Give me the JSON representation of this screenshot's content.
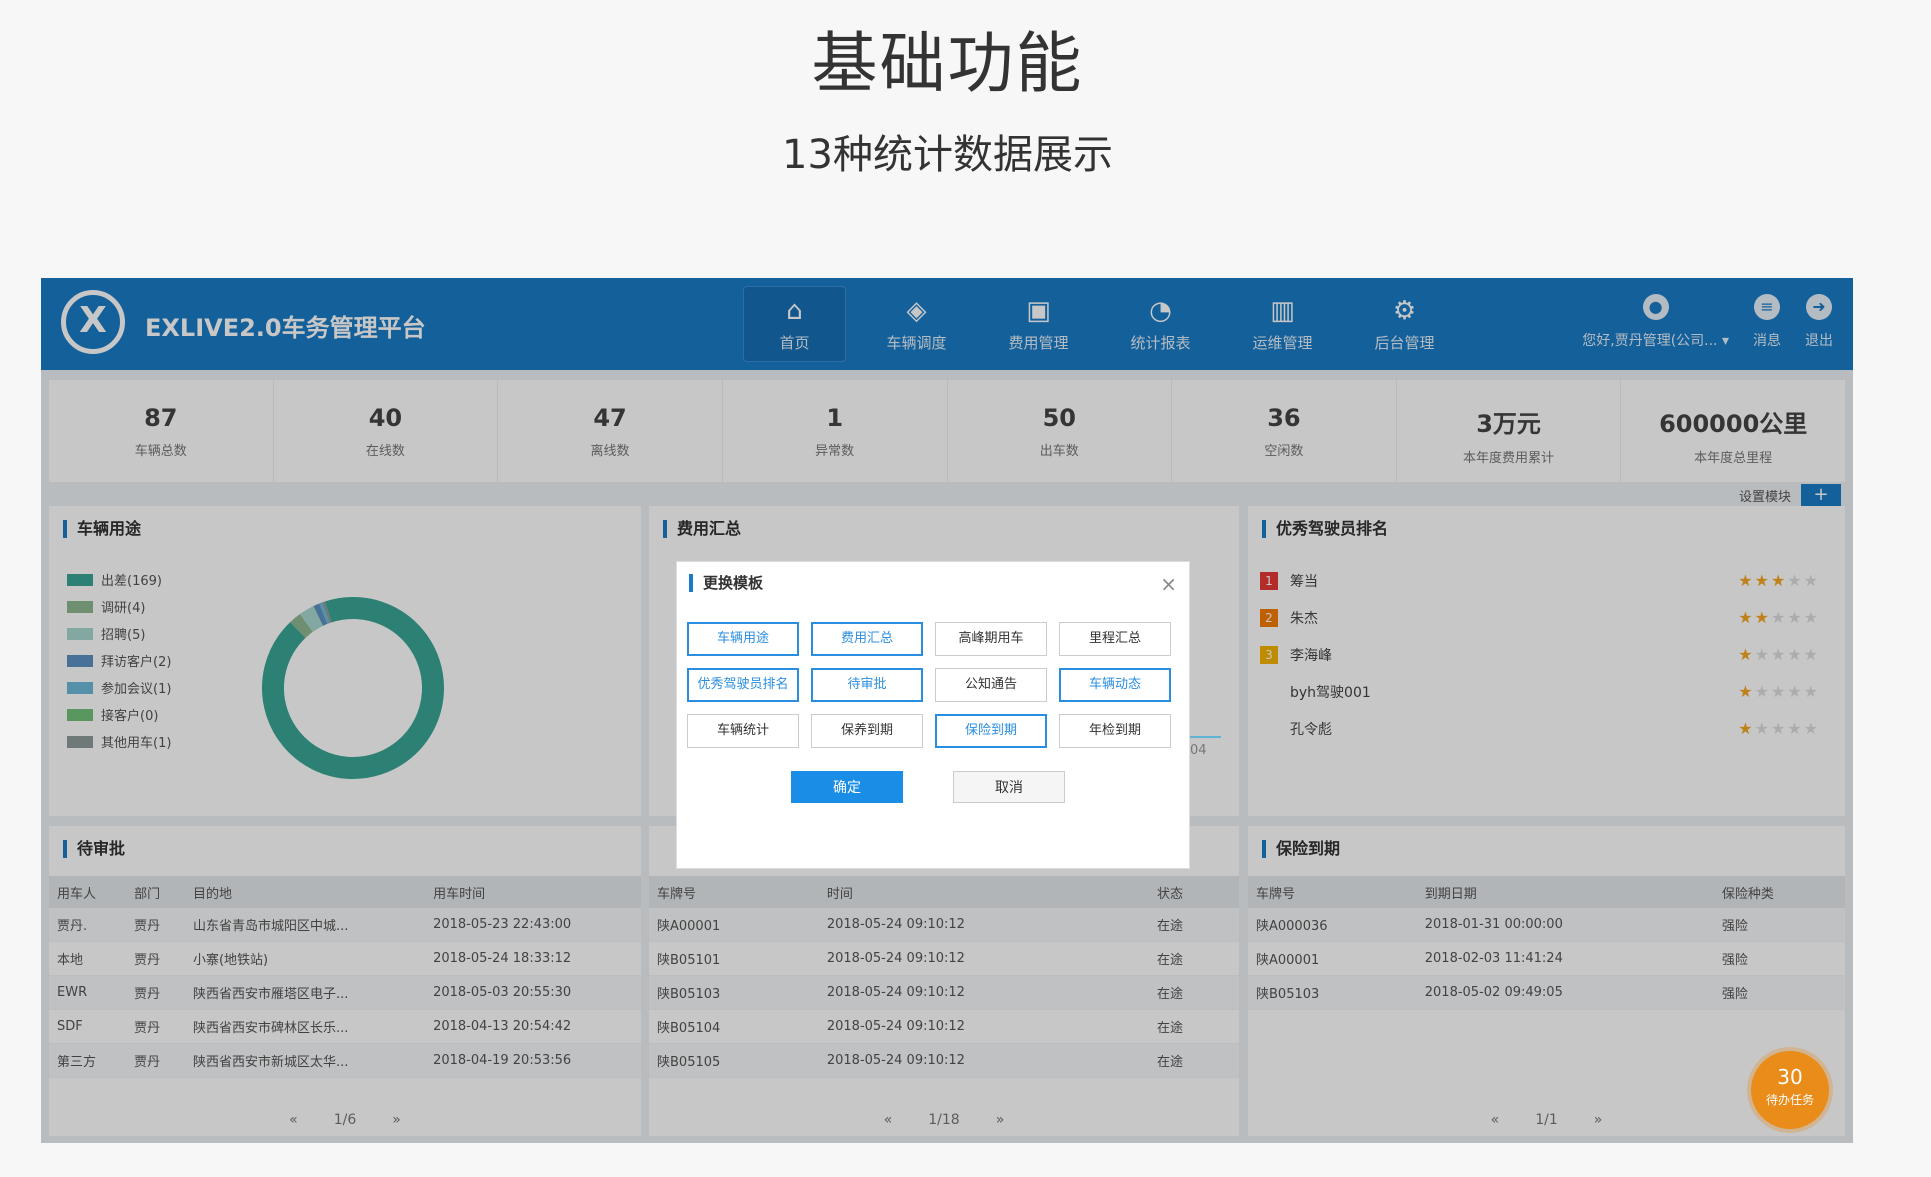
{
  "hero": {
    "title": "基础功能",
    "subtitle": "13种统计数据展示"
  },
  "app": {
    "title": "EXLIVE2.0车务管理平台",
    "logo_letter": "X",
    "nav": [
      {
        "label": "首页",
        "icon": "⌂"
      },
      {
        "label": "车辆调度",
        "icon": "◈"
      },
      {
        "label": "费用管理",
        "icon": "▣"
      },
      {
        "label": "统计报表",
        "icon": "◔"
      },
      {
        "label": "运维管理",
        "icon": "▥"
      },
      {
        "label": "后台管理",
        "icon": "⚙"
      }
    ],
    "user": {
      "greeting": "您好,贾丹管理(公司... ▾",
      "message": "消息",
      "logout": "退出"
    }
  },
  "stats": [
    {
      "value": "87",
      "label": "车辆总数"
    },
    {
      "value": "40",
      "label": "在线数"
    },
    {
      "value": "47",
      "label": "离线数"
    },
    {
      "value": "1",
      "label": "异常数"
    },
    {
      "value": "50",
      "label": "出车数"
    },
    {
      "value": "36",
      "label": "空闲数"
    },
    {
      "value": "3万元",
      "label": "本年度费用累计"
    },
    {
      "value": "600000公里",
      "label": "本年度总里程"
    }
  ],
  "settings_label": "设置模块",
  "vehicle_use": {
    "title": "车辆用途",
    "legend": [
      {
        "label": "出差(169)",
        "value": 169,
        "color": "#3aa695"
      },
      {
        "label": "调研(4)",
        "value": 4,
        "color": "#8fb891"
      },
      {
        "label": "招聘(5)",
        "value": 5,
        "color": "#a8d7cf"
      },
      {
        "label": "拜访客户(2)",
        "value": 2,
        "color": "#5b91c2"
      },
      {
        "label": "参加会议(1)",
        "value": 1,
        "color": "#6cb9d8"
      },
      {
        "label": "接客户(0)",
        "value": 0,
        "color": "#74c27a"
      },
      {
        "label": "其他用车(1)",
        "value": 1,
        "color": "#8e9c9c"
      }
    ]
  },
  "fee_summary": {
    "title": "费用汇总",
    "partial_label": "04"
  },
  "driver_rank": {
    "title": "优秀驾驶员排名",
    "items": [
      {
        "rank": "1",
        "name": "筹当",
        "stars": 3,
        "rank_color": "#e53935"
      },
      {
        "rank": "2",
        "name": "朱杰",
        "stars": 2,
        "rank_color": "#f57c00"
      },
      {
        "rank": "3",
        "name": "李海峰",
        "stars": 1,
        "rank_color": "#f5b400"
      },
      {
        "rank": "",
        "name": "byh驾驶001",
        "stars": 1,
        "rank_color": ""
      },
      {
        "rank": "",
        "name": "孔令彪",
        "stars": 1,
        "rank_color": ""
      }
    ]
  },
  "pending": {
    "title": "待审批",
    "headers": [
      "用车人",
      "部门",
      "目的地",
      "用车时间"
    ],
    "rows": [
      [
        "贾丹.",
        "贾丹",
        "山东省青岛市城阳区中城...",
        "2018-05-23 22:43:00"
      ],
      [
        "本地",
        "贾丹",
        "小寨(地铁站)",
        "2018-05-24 18:33:12"
      ],
      [
        "EWR",
        "贾丹",
        "陕西省西安市雁塔区电子...",
        "2018-05-03 20:55:30"
      ],
      [
        "SDF",
        "贾丹",
        "陕西省西安市碑林区长乐...",
        "2018-04-13 20:54:42"
      ],
      [
        "第三方",
        "贾丹",
        "陕西省西安市新城区太华...",
        "2018-04-19 20:53:56"
      ]
    ],
    "pager": {
      "prev": "«",
      "page": "1/6",
      "next": "»"
    }
  },
  "vehicle_status": {
    "headers": [
      "车牌号",
      "时间",
      "状态"
    ],
    "rows": [
      [
        "陕A00001",
        "2018-05-24 09:10:12",
        "在途"
      ],
      [
        "陕B05101",
        "2018-05-24 09:10:12",
        "在途"
      ],
      [
        "陕B05103",
        "2018-05-24 09:10:12",
        "在途"
      ],
      [
        "陕B05104",
        "2018-05-24 09:10:12",
        "在途"
      ],
      [
        "陕B05105",
        "2018-05-24 09:10:12",
        "在途"
      ]
    ],
    "pager": {
      "prev": "«",
      "page": "1/18",
      "next": "»"
    }
  },
  "insurance": {
    "title": "保险到期",
    "headers": [
      "车牌号",
      "到期日期",
      "保险种类"
    ],
    "rows": [
      [
        "陕A000036",
        "2018-01-31 00:00:00",
        "强险"
      ],
      [
        "陕A00001",
        "2018-02-03 11:41:24",
        "强险"
      ],
      [
        "陕B05103",
        "2018-05-02 09:49:05",
        "强险"
      ]
    ],
    "pager": {
      "prev": "«",
      "page": "1/1",
      "next": "»"
    }
  },
  "modal": {
    "title": "更换模板",
    "close": "×",
    "options": [
      {
        "label": "车辆用途",
        "selected": true
      },
      {
        "label": "费用汇总",
        "selected": true
      },
      {
        "label": "高峰期用车",
        "selected": false
      },
      {
        "label": "里程汇总",
        "selected": false
      },
      {
        "label": "优秀驾驶员排名",
        "selected": true
      },
      {
        "label": "待审批",
        "selected": true
      },
      {
        "label": "公知通告",
        "selected": false
      },
      {
        "label": "车辆动态",
        "selected": true
      },
      {
        "label": "车辆统计",
        "selected": false
      },
      {
        "label": "保养到期",
        "selected": false
      },
      {
        "label": "保险到期",
        "selected": true
      },
      {
        "label": "年检到期",
        "selected": false
      }
    ],
    "ok": "确定",
    "cancel": "取消"
  },
  "task_badge": {
    "count": "30",
    "label": "待办任务"
  }
}
